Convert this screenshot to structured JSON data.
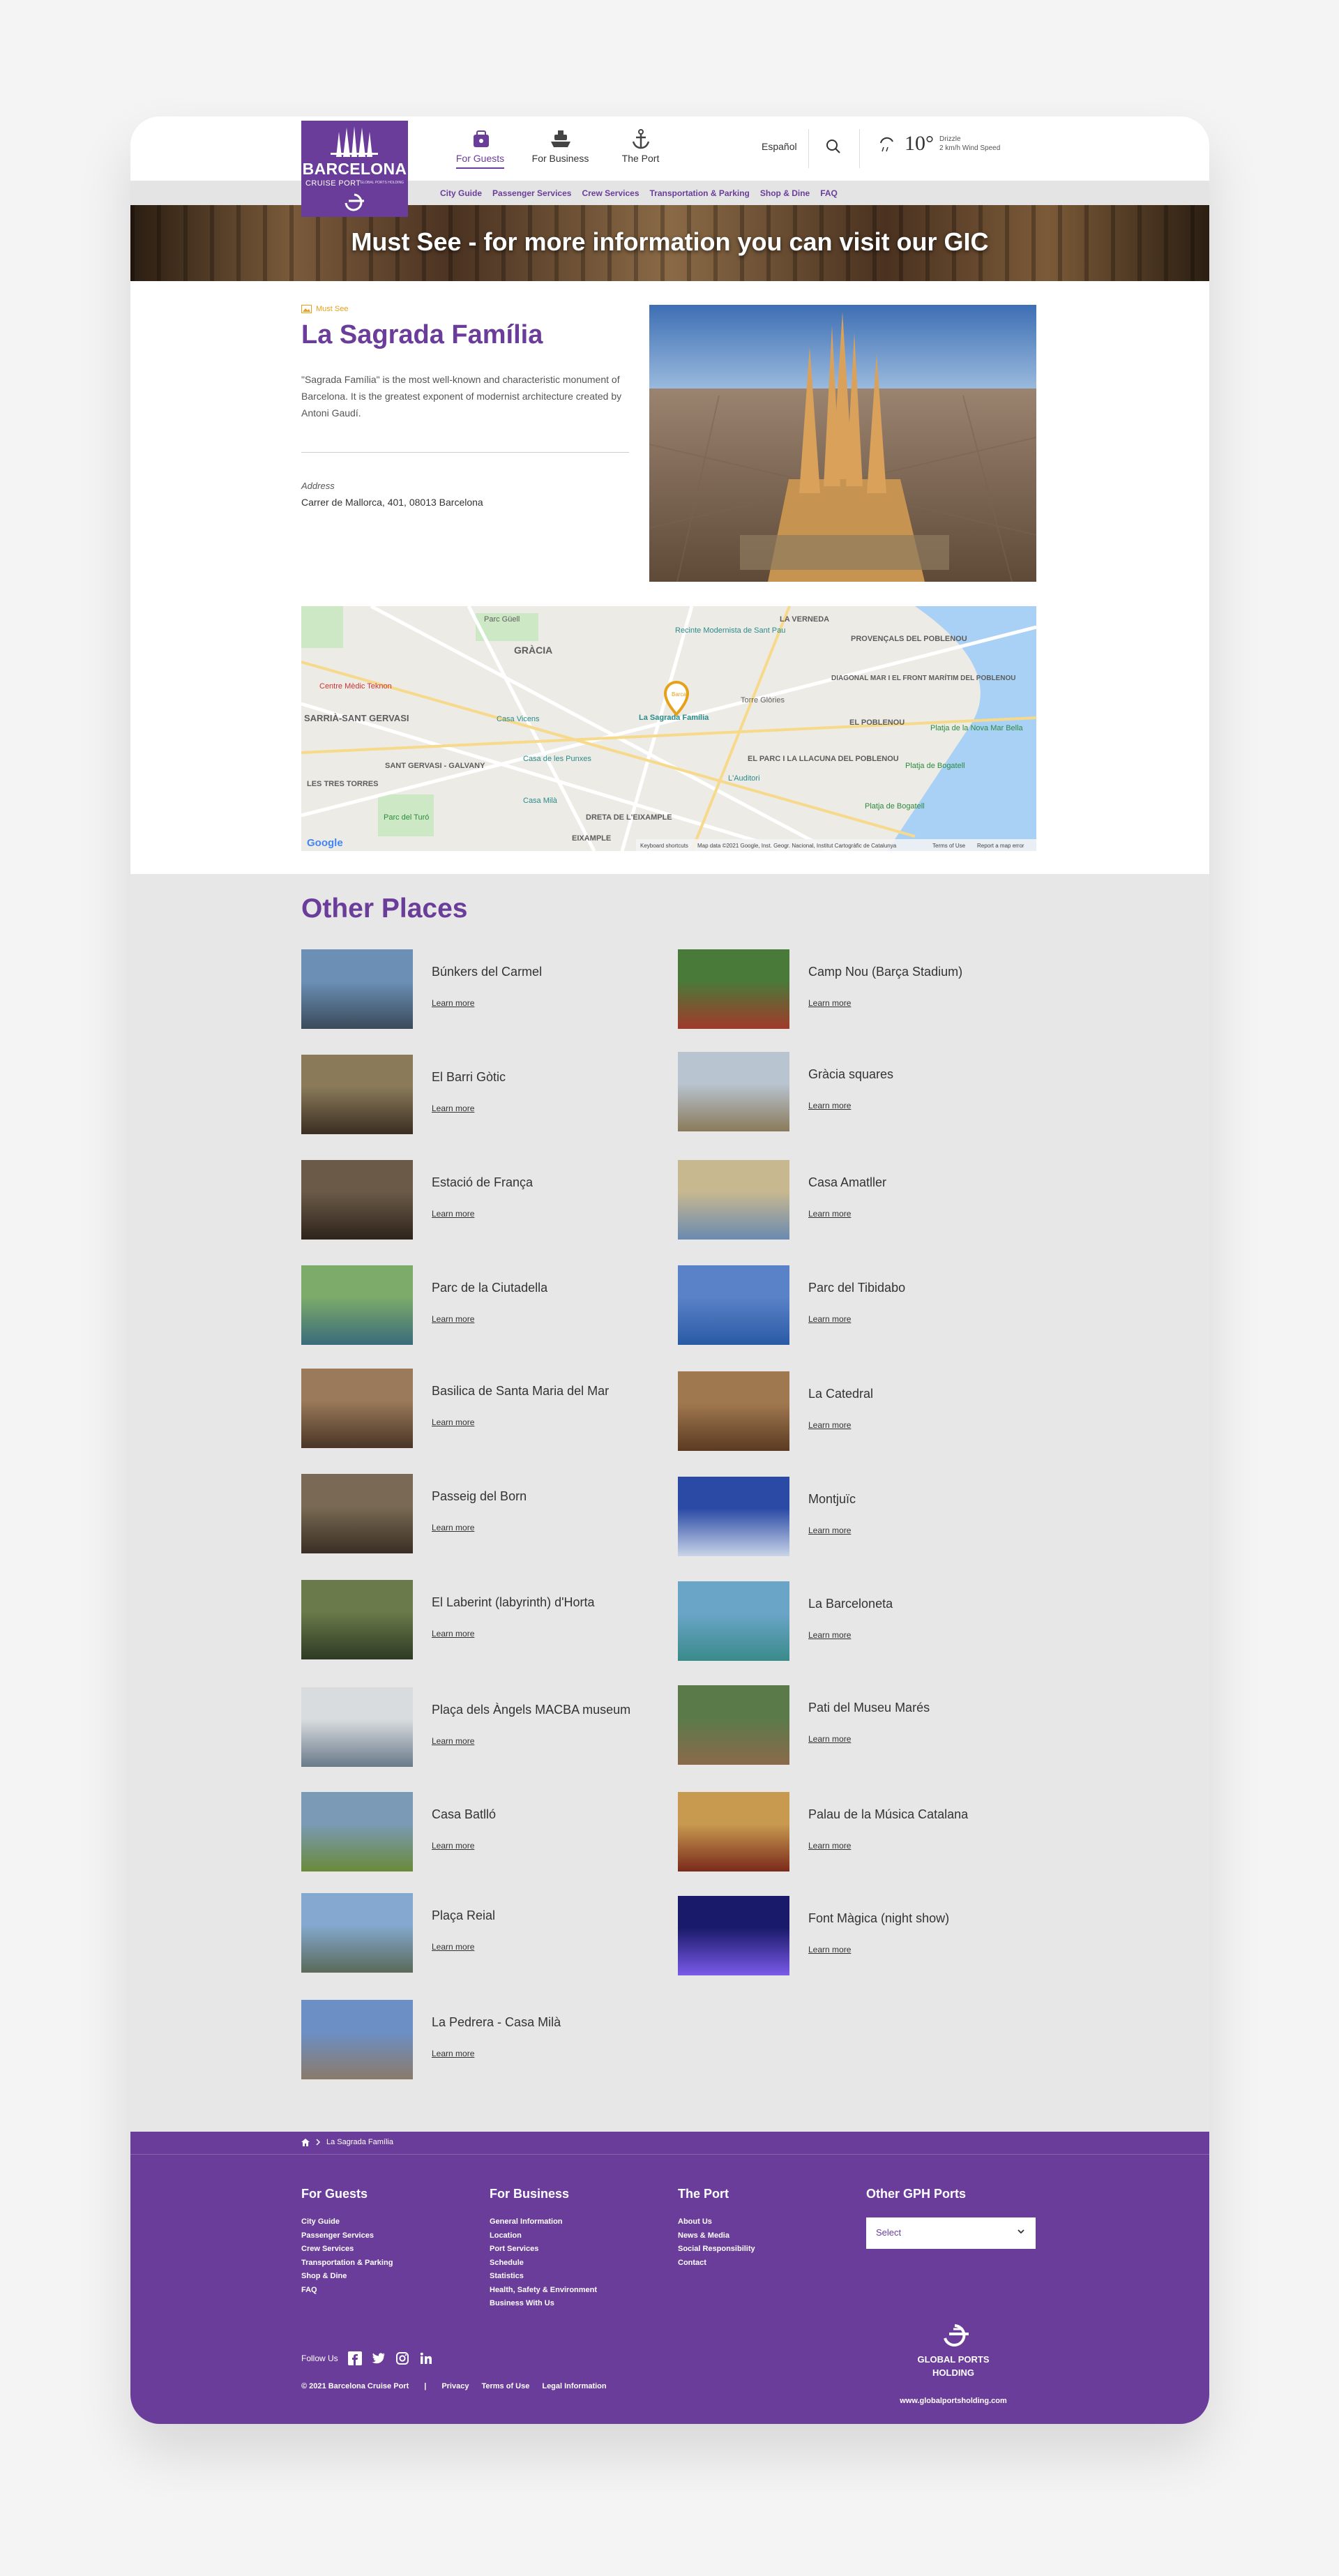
{
  "brand": {
    "name": "BARCELONA",
    "sub": "CRUISE PORT",
    "tiny": "GLOBAL PORTS HOLDING"
  },
  "nav": {
    "main": [
      {
        "label": "For Guests",
        "icon": "suitcase-icon"
      },
      {
        "label": "For Business",
        "icon": "ship-icon"
      },
      {
        "label": "The Port",
        "icon": "anchor-icon"
      }
    ],
    "language": "Español",
    "sub": [
      "City Guide",
      "Passenger Services",
      "Crew Services",
      "Transportation & Parking",
      "Shop & Dine",
      "FAQ"
    ]
  },
  "weather": {
    "temp": "10°",
    "line1": "Drizzle",
    "line2": "2 km/h Wind Speed"
  },
  "hero": {
    "title": "Must See - for more information you can visit our GIC"
  },
  "detail": {
    "tag": "Must See",
    "title": "La Sagrada Família",
    "description": "\"Sagrada Família\" is the most well-known and characteristic monument of Barcelona. It is the greatest exponent of modernist architecture created by Antoni Gaudí.",
    "address_label": "Address",
    "address": "Carrer de Mallorca, 401, 08013 Barcelona"
  },
  "map": {
    "labels": [
      "Parc Güell",
      "GRÀCIA",
      "Recinte Modernista de Sant Pau",
      "LA VERNEDA",
      "PROVENÇALS DEL POBLENOU",
      "DIAGONAL MAR I EL FRONT MARÍTIM DEL POBLENOU",
      "Centre Mèdic Teknon",
      "SARRIÀ-SANT GERVASI",
      "Casa Vicens",
      "La Sagrada Família",
      "Torre Glòries",
      "EL POBLENOU",
      "Platja de la Nova Mar Bella",
      "SANT GERVASI - GALVANY",
      "Casa de les Punxes",
      "EL PARC I LA LLACUNA DEL POBLENOU",
      "Platja de Bogatell",
      "LES TRES TORRES",
      "Casa Milà",
      "L'Auditori",
      "Parc del Turó",
      "DRETA DE L'EIXAMPLE",
      "Platja de Bogatell",
      "EIXAMPLE"
    ],
    "pin_label": "Barca",
    "google": "Google",
    "footer": [
      "Keyboard shortcuts",
      "Map data ©2021 Google, Inst. Geogr. Nacional, Institut Cartogràfic de Catalunya",
      "Terms of Use",
      "Report a map error"
    ]
  },
  "others": {
    "title": "Other Places",
    "learn_more": "Learn more",
    "left": [
      "Búnkers del Carmel",
      "El Barri Gòtic",
      "Estació de França",
      "Parc de la Ciutadella",
      "Basilica de Santa Maria del Mar",
      "Passeig del Born",
      "El Laberint (labyrinth) d'Horta",
      "Plaça dels Àngels MACBA museum",
      "Casa Batlló",
      "Plaça Reial",
      "La Pedrera - Casa Milà"
    ],
    "right": [
      "Camp Nou (Barça Stadium)",
      "Gràcia squares",
      "Casa Amatller",
      "Parc del Tibidabo",
      "La Catedral",
      "Montjuïc",
      "La Barceloneta",
      "Pati del Museu Marés",
      "Palau de la Música Catalana",
      "Font Màgica (night show)"
    ]
  },
  "footer": {
    "breadcrumb": "La Sagrada Família",
    "cols": [
      {
        "title": "For Guests",
        "links": [
          "City Guide",
          "Passenger Services",
          "Crew Services",
          "Transportation & Parking",
          "Shop & Dine",
          "FAQ"
        ]
      },
      {
        "title": "For Business",
        "links": [
          "General Information",
          "Location",
          "Port Services",
          "Schedule",
          "Statistics",
          "Health, Safety & Environment",
          "Business With Us"
        ]
      },
      {
        "title": "The Port",
        "links": [
          "About Us",
          "News & Media",
          "Social Responsibility",
          "Contact"
        ]
      }
    ],
    "ports_title": "Other GPH Ports",
    "select_value": "Select",
    "follow": "Follow Us",
    "copyright": "© 2021 Barcelona Cruise Port",
    "legal": [
      "Privacy",
      "Terms of Use",
      "Legal Information"
    ],
    "gph_name_1": "GLOBAL PORTS",
    "gph_name_2": "HOLDING",
    "gph_url": "www.globalportsholding.com"
  },
  "colors": {
    "brand": "#6a3d9a",
    "accent": "#e6a11b",
    "gray_bg": "#e7e7e7"
  }
}
